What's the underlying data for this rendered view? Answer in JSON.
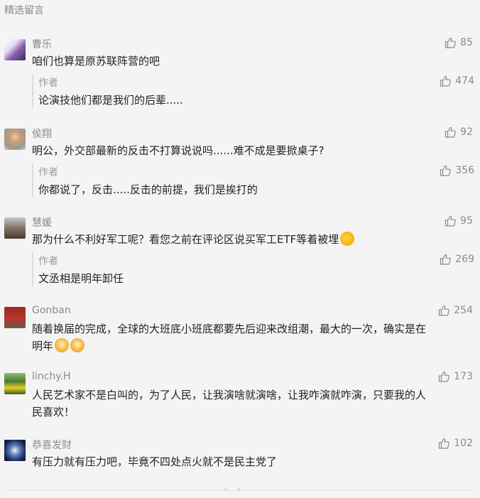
{
  "section_title": "精选留言",
  "comments": [
    {
      "name": "曹乐",
      "text": "咱们也算是原苏联阵营的吧",
      "likes": "85",
      "reply": {
        "author": "作者",
        "text": "论演技他们都是我们的后辈.....",
        "likes": "474"
      }
    },
    {
      "name": "侯翔",
      "text": "明公，外交部最新的反击不打算说说吗......难不成是要掀桌子?",
      "likes": "92",
      "reply": {
        "author": "作者",
        "text": "你都说了，反击.....反击的前提，我们是挨打的",
        "likes": "356"
      }
    },
    {
      "name": "慧媛",
      "text": "那为什么不利好军工呢？看您之前在评论区说买军工ETF等着被埋",
      "likes": "95",
      "reply": {
        "author": "作者",
        "text": "文丞相是明年卸任",
        "likes": "269"
      }
    },
    {
      "name": "Gonban",
      "text_line1": "随着换届的完成，全球的大班底小班底都要先后迎来改组潮，最大的一次，确实是在",
      "text_line2": "明年",
      "likes": "254"
    },
    {
      "name": "linchy.H",
      "text_line1": "人民艺术家不是白叫的，为了人民，让我演啥就演啥，让我咋演就咋演，只要我的人",
      "text_line2": "民喜欢！",
      "likes": "173"
    },
    {
      "name": "恭喜发财",
      "text": "有压力就有压力吧，毕竟不四处点火就不是民主党了",
      "likes": "102"
    }
  ],
  "icons": {
    "like": "thumbs-up-icon"
  },
  "colors": {
    "background": "#f4f4f4",
    "meta_text": "#8a8a8a",
    "body_text": "#222222"
  }
}
